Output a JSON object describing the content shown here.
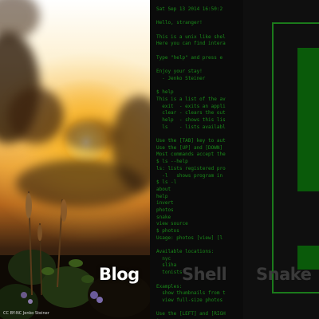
{
  "blog": {
    "label": "Blog",
    "caption": "CC BY-NC Jenko Steiner"
  },
  "shell": {
    "label": "Shell",
    "lines": [
      "Sat Sep 13 2014 16:50:2",
      "",
      "Hello, stranger!",
      "",
      "This is a unix like shel",
      "Here you can find intera",
      "",
      "Type \"help\" and press e",
      "",
      "Enjoy your stay!",
      "  - Jenko Steiner",
      "",
      "$ help",
      "This is a list of the av",
      "  exit  - exits an appli",
      "  clear - clears the out",
      "  help  - shows this lis",
      "  ls    - lists availabl",
      "",
      "Use the [TAB] key to aut",
      "Use the [UP] and [DOWN]",
      "Most commands accept the",
      "$ ls --help",
      "ls: lists registered pro",
      "  -l   shows program in",
      "$ ls -l",
      "about",
      "help",
      "invert",
      "photos",
      "snake",
      "view source",
      "$ photos",
      "Usage: photos [view] [l",
      "",
      "Available locations:",
      "  nyc",
      "  sliha",
      "  tonists",
      "",
      "Examples:",
      "  show thumbnails from t",
      "  view full-size photos",
      "",
      "Use the [LEFT] and [RIGH",
      "$"
    ]
  },
  "snake": {
    "label": "Snake"
  },
  "colors": {
    "terminal_green": "#1a8a1a",
    "snake_green": "#0a5a0a",
    "label_dim": "#3a3a3a"
  }
}
